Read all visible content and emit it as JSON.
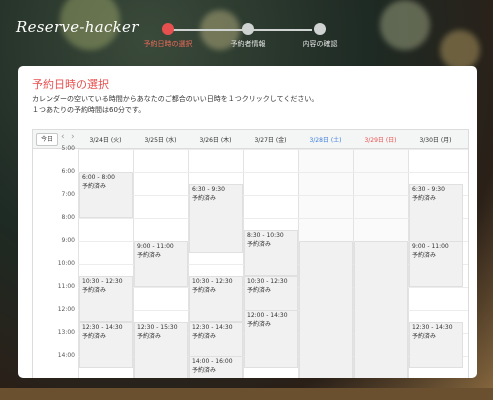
{
  "brand": {
    "logo_text": "Reserve-hacker"
  },
  "steps": [
    {
      "label": "予約日時の選択",
      "active": true
    },
    {
      "label": "予約者情報",
      "active": false
    },
    {
      "label": "内容の確認",
      "active": false
    }
  ],
  "page": {
    "title": "予約日時の選択",
    "desc_line1": "カレンダーの空いている時間からあなたのご都合のいい日時を１つクリックしてください。",
    "desc_line2": "１つあたりの予約時間は60分です。"
  },
  "calendar": {
    "today_label": "今日",
    "prev_icon": "chevron-left-icon",
    "next_icon": "chevron-right-icon",
    "days": [
      {
        "label": "3/24日 (火)",
        "color": "#333333"
      },
      {
        "label": "3/25日 (水)",
        "color": "#333333"
      },
      {
        "label": "3/26日 (木)",
        "color": "#333333"
      },
      {
        "label": "3/27日 (金)",
        "color": "#333333"
      },
      {
        "label": "3/28日 (土)",
        "color": "#3b7fd9"
      },
      {
        "label": "3/29日 (日)",
        "color": "#e8504f"
      },
      {
        "label": "3/30日 (月)",
        "color": "#333333"
      }
    ],
    "times": [
      "5:00",
      "6:00",
      "7:00",
      "8:00",
      "9:00",
      "10:00",
      "11:00",
      "12:00",
      "13:00",
      "14:00"
    ],
    "booked_label": "予約済み",
    "events": [
      {
        "day": 0,
        "time": "6:00 - 8:00",
        "status": "予約済み",
        "start": 6.0,
        "end": 8.0
      },
      {
        "day": 0,
        "time": "10:30 - 12:30",
        "status": "予約済み",
        "start": 10.5,
        "end": 12.5
      },
      {
        "day": 0,
        "time": "12:30 - 14:30",
        "status": "予約済み",
        "start": 12.5,
        "end": 14.5
      },
      {
        "day": 1,
        "time": "9:00 - 11:00",
        "status": "予約済み",
        "start": 9.0,
        "end": 11.0
      },
      {
        "day": 1,
        "time": "12:30 - 15:30",
        "status": "予約済み",
        "start": 12.5,
        "end": 15.5
      },
      {
        "day": 2,
        "time": "6:30 - 9:30",
        "status": "予約済み",
        "start": 6.5,
        "end": 9.5
      },
      {
        "day": 2,
        "time": "10:30 - 12:30",
        "status": "予約済み",
        "start": 10.5,
        "end": 12.5
      },
      {
        "day": 2,
        "time": "12:30 - 14:30",
        "status": "予約済み",
        "start": 12.5,
        "end": 14.5
      },
      {
        "day": 2,
        "time": "14:00 - 16:00",
        "status": "予約済み",
        "start": 14.0,
        "end": 16.0
      },
      {
        "day": 3,
        "time": "8:30 - 10:30",
        "status": "予約済み",
        "start": 8.5,
        "end": 10.5
      },
      {
        "day": 3,
        "time": "10:30 - 12:30",
        "status": "予約済み",
        "start": 10.5,
        "end": 12.5
      },
      {
        "day": 3,
        "time": "12:00 - 14:30",
        "status": "予約済み",
        "start": 12.0,
        "end": 14.5
      },
      {
        "day": 4,
        "time": "",
        "status": "",
        "start": 9.0,
        "end": 16.0
      },
      {
        "day": 5,
        "time": "",
        "status": "",
        "start": 9.0,
        "end": 16.0
      },
      {
        "day": 6,
        "time": "6:30 - 9:30",
        "status": "予約済み",
        "start": 6.5,
        "end": 9.5
      },
      {
        "day": 6,
        "time": "9:00 - 11:00",
        "status": "予約済み",
        "start": 9.0,
        "end": 11.0
      },
      {
        "day": 6,
        "time": "12:30 - 14:30",
        "status": "予約済み",
        "start": 12.5,
        "end": 14.5
      }
    ]
  }
}
